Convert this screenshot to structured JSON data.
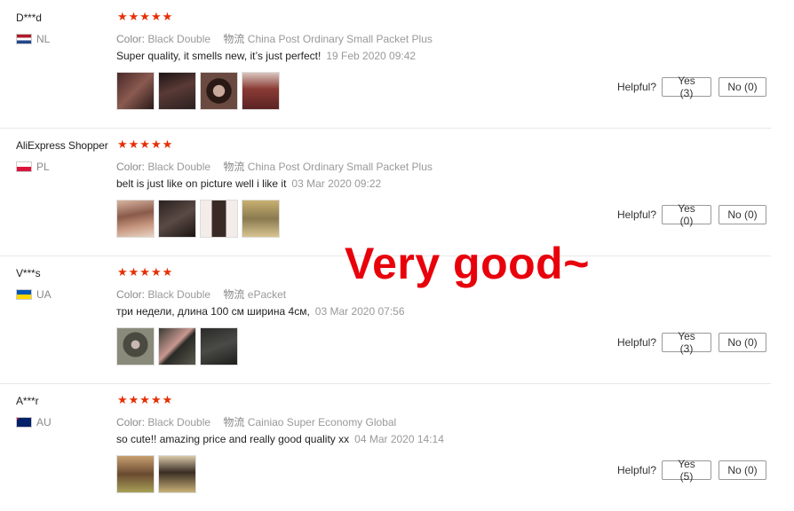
{
  "reviews": [
    {
      "user": "D***d",
      "country": "NL",
      "stars": "★★★★★",
      "color_label": "Color:",
      "color_value": "Black Double",
      "logistics_label": "物流",
      "logistics_value": "China Post Ordinary Small Packet Plus",
      "text": "Super quality, it smells new, it’s just perfect!",
      "date": "19 Feb 2020 09:42",
      "helpful_label": "Helpful?",
      "yes_label": "Yes (3)",
      "no_label": "No (0)"
    },
    {
      "user": "AliExpress Shopper",
      "country": "PL",
      "stars": "★★★★★",
      "color_label": "Color:",
      "color_value": "Black Double",
      "logistics_label": "物流",
      "logistics_value": "China Post Ordinary Small Packet Plus",
      "text": "belt is just like on picture well i like it",
      "date": "03 Mar 2020 09:22",
      "helpful_label": "Helpful?",
      "yes_label": "Yes (0)",
      "no_label": "No (0)"
    },
    {
      "user": "V***s",
      "country": "UA",
      "stars": "★★★★★",
      "color_label": "Color:",
      "color_value": "Black Double",
      "logistics_label": "物流",
      "logistics_value": "ePacket",
      "text": "три недели, длина 100 см ширина 4см,",
      "date": "03 Mar 2020 07:56",
      "helpful_label": "Helpful?",
      "yes_label": "Yes (3)",
      "no_label": "No (0)"
    },
    {
      "user": "A***r",
      "country": "AU",
      "stars": "★★★★★",
      "color_label": "Color:",
      "color_value": "Black Double",
      "logistics_label": "物流",
      "logistics_value": "Cainiao Super Economy Global",
      "text": "so cute!! amazing price and really good quality xx",
      "date": "04 Mar 2020 14:14",
      "helpful_label": "Helpful?",
      "yes_label": "Yes (5)",
      "no_label": "No (0)"
    }
  ],
  "overlay_text": "Very good~"
}
